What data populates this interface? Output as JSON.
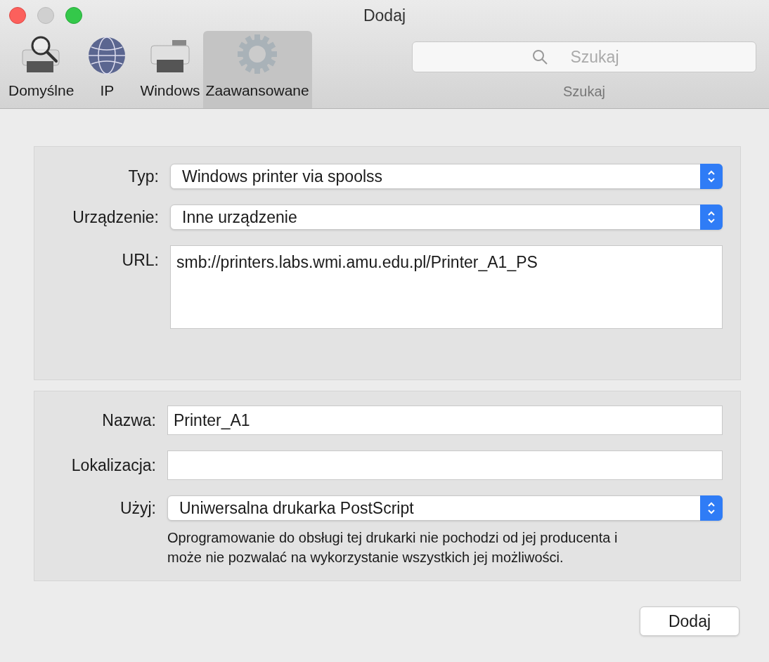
{
  "window": {
    "title": "Dodaj"
  },
  "toolbar": {
    "tabs": [
      {
        "label": "Domyślne",
        "kind": "printer-search",
        "selected": false
      },
      {
        "label": "IP",
        "kind": "globe",
        "selected": false
      },
      {
        "label": "Windows",
        "kind": "printer",
        "selected": false
      },
      {
        "label": "Zaawansowane",
        "kind": "gear",
        "selected": true
      }
    ],
    "search": {
      "placeholder": "Szukaj",
      "label": "Szukaj"
    }
  },
  "connection": {
    "fields": [
      {
        "label": "Typ:",
        "kind": "select",
        "value": "Windows printer via spoolss"
      },
      {
        "label": "Urządzenie:",
        "kind": "select",
        "value": "Inne urządzenie"
      },
      {
        "label": "URL:",
        "kind": "textarea",
        "value": "smb://printers.labs.wmi.amu.edu.pl/Printer_A1_PS"
      }
    ]
  },
  "printer": {
    "fields": [
      {
        "label": "Nazwa:",
        "kind": "text",
        "value": "Printer_A1"
      },
      {
        "label": "Lokalizacja:",
        "kind": "text"
      },
      {
        "label": "Użyj:",
        "kind": "select",
        "value": "Uniwersalna drukarka PostScript"
      }
    ],
    "note": "Oprogramowanie do obsługi tej drukarki nie pochodzi od jej producenta i może nie pozwalać na wykorzystanie wszystkich jej możliwości."
  },
  "buttons": [
    {
      "label": "Dodaj"
    }
  ]
}
